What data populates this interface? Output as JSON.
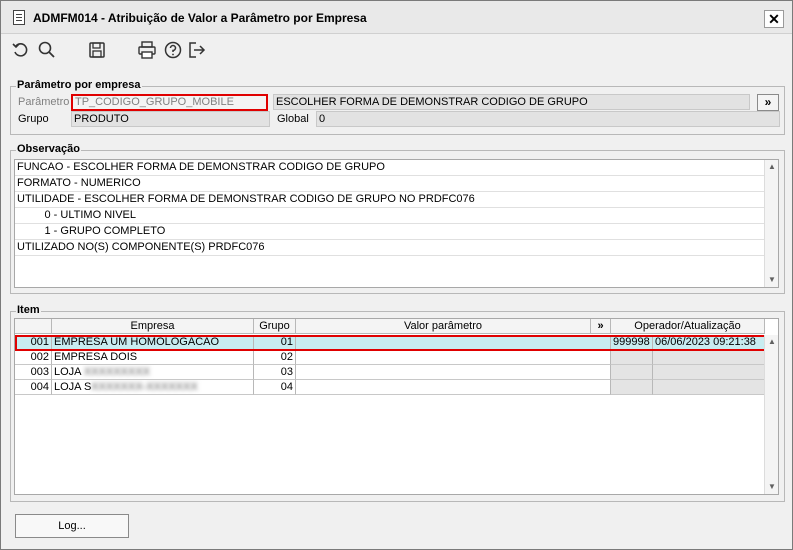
{
  "window": {
    "title": "ADMFM014 - Atribuição de Valor a Parâmetro por Empresa",
    "close_glyph": "✕"
  },
  "toolbar": {
    "icons": [
      "undo-icon",
      "search-icon",
      "save-icon",
      "print-icon",
      "help-icon",
      "exit-icon"
    ]
  },
  "param_group": {
    "title": "Parâmetro por empresa",
    "parametro_label": "Parâmetro",
    "parametro_value": "TP_CODIGO_GRUPO_MOBILE",
    "description": "ESCOLHER FORMA DE DEMONSTRAR CODIGO DE GRUPO",
    "expand_label": "»",
    "grupo_label": "Grupo",
    "grupo_value": "PRODUTO",
    "global_label": "Global",
    "global_value": "0"
  },
  "obs_group": {
    "title": "Observação",
    "lines": [
      "FUNCAO - ESCOLHER FORMA DE DEMONSTRAR CODIGO DE GRUPO",
      "FORMATO - NUMERICO",
      "UTILIDADE - ESCOLHER FORMA DE DEMONSTRAR CODIGO DE GRUPO NO PRDFC076",
      "         0 - ULTIMO NIVEL",
      "         1 - GRUPO COMPLETO",
      "UTILIZADO NO(S) COMPONENTE(S) PRDFC076"
    ]
  },
  "item_group": {
    "title": "Item",
    "columns": {
      "empresa": "Empresa",
      "grupo": "Grupo",
      "valor": "Valor parâmetro",
      "expand": "»",
      "operador": "Operador/Atualização"
    },
    "rows": [
      {
        "code": "001",
        "empresa": "EMPRESA UM HOMOLOGACAO",
        "empresa_blur": "",
        "grupo": "01",
        "valor": "",
        "operador": "999998",
        "data": "06/06/2023 09:21:38"
      },
      {
        "code": "002",
        "empresa": "EMPRESA DOIS",
        "empresa_blur": "",
        "grupo": "02",
        "valor": "",
        "operador": "",
        "data": ""
      },
      {
        "code": "003",
        "empresa": "LOJA",
        "empresa_blur": "XXXXXXXXX",
        "grupo": "03",
        "valor": "",
        "operador": "",
        "data": ""
      },
      {
        "code": "004",
        "empresa": "LOJA S",
        "empresa_blur": "XXXXXXX-XXXXXXX",
        "grupo": "04",
        "valor": "",
        "operador": "",
        "data": ""
      }
    ]
  },
  "footer": {
    "log_label": "Log..."
  },
  "scroll": {
    "up": "▲",
    "down": "▼"
  }
}
